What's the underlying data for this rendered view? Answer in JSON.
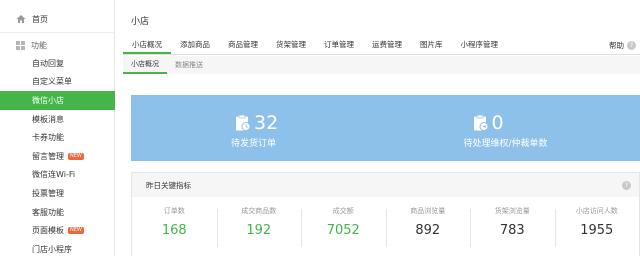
{
  "sidebar": {
    "home": {
      "label": "首页",
      "icon": "home-icon"
    },
    "section": {
      "label": "功能",
      "icon": "grid-icon"
    },
    "items": [
      {
        "label": "自动回复",
        "badge": ""
      },
      {
        "label": "自定义菜单",
        "badge": ""
      },
      {
        "label": "微信小店",
        "badge": "",
        "active": true
      },
      {
        "label": "模板消息",
        "badge": ""
      },
      {
        "label": "卡券功能",
        "badge": ""
      },
      {
        "label": "留言管理",
        "badge": "NEW"
      },
      {
        "label": "微信连Wi-Fi",
        "badge": ""
      },
      {
        "label": "投票管理",
        "badge": ""
      },
      {
        "label": "客服功能",
        "badge": ""
      },
      {
        "label": "页面模板",
        "badge": "NEW"
      },
      {
        "label": "门店小程序",
        "badge": ""
      }
    ]
  },
  "header": {
    "title": "小店"
  },
  "tabs": [
    "小店概况",
    "添加商品",
    "商品管理",
    "货架管理",
    "订单管理",
    "运费管理",
    "图片库",
    "小程序管理"
  ],
  "help": {
    "label": "帮助",
    "icon_text": "?"
  },
  "subtabs": [
    "小店概况",
    "数据推送"
  ],
  "banner": {
    "left": {
      "value": "32",
      "label": "待发货订单"
    },
    "right": {
      "value": "0",
      "label": "待处理维权/仲裁单数"
    }
  },
  "stats": {
    "title": "昨日关键指标",
    "help_text": "?",
    "items": [
      {
        "label": "订单数",
        "value": "168"
      },
      {
        "label": "成交商品数",
        "value": "192"
      },
      {
        "label": "成交额",
        "value": "7052"
      },
      {
        "label": "商品浏览量",
        "value": "892"
      },
      {
        "label": "货架浏览量",
        "value": "783"
      },
      {
        "label": "小店访问人数",
        "value": "1955"
      }
    ]
  }
}
